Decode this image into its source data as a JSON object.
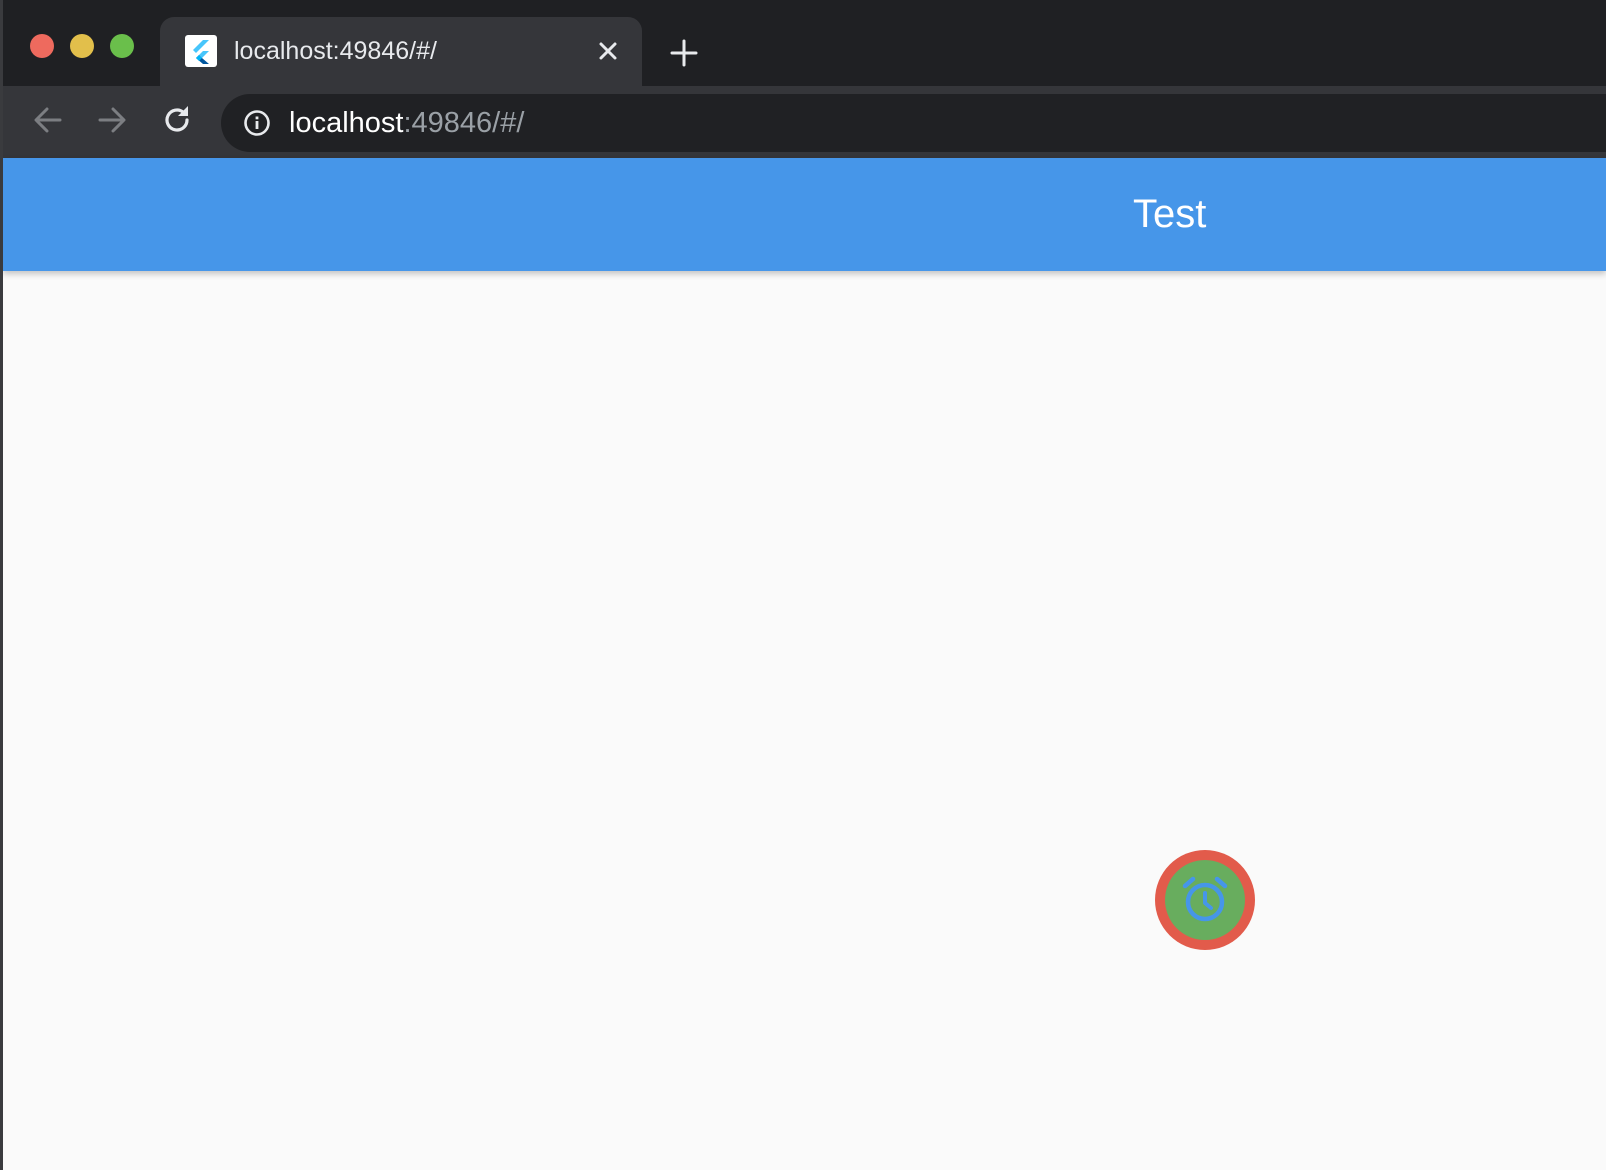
{
  "window": {
    "traffic_lights": {
      "close_color": "#ee6a5e",
      "minimize_color": "#e2bf4b",
      "maximize_color": "#6abf4b"
    }
  },
  "tab": {
    "title": "localhost:49846/#/",
    "favicon": "flutter-logo"
  },
  "toolbar": {
    "url_host": "localhost",
    "url_rest": ":49846/#/"
  },
  "app": {
    "title": "Test",
    "appbar_color": "#4696e9",
    "fab": {
      "icon": "alarm-icon",
      "ring_color": "#e25b4b",
      "fill_color": "#68ad5e",
      "icon_color": "#4696e9"
    }
  }
}
